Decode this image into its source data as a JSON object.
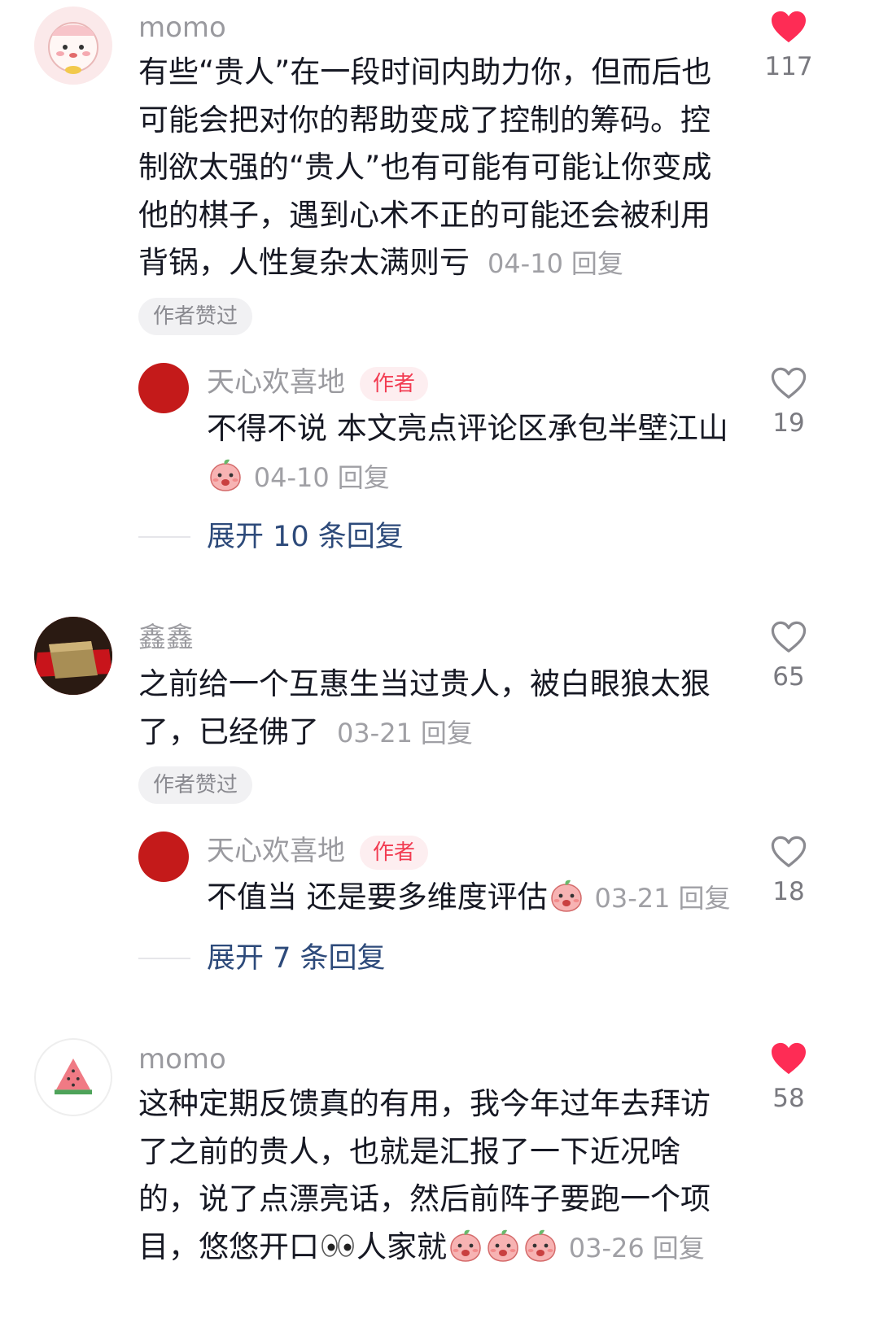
{
  "comments": [
    {
      "username": "momo",
      "text": "有些“贵人”在一段时间内助力你，但而后也可能会把对你的帮助变成了控制的筹码。控制欲太强的“贵人”也有可能有可能让你变成他的棋子，遇到心术不正的可能还会被利用背锅，人性复杂太满则亏",
      "date": "04-10",
      "reply_label": "回复",
      "chip": "作者赞过",
      "likes": "117",
      "liked": true,
      "replies": {
        "username": "天心欢喜地",
        "author_tag": "作者",
        "text": "不得不说 本文亮点评论区承包半壁江山",
        "emoji": "peach-emoji",
        "date": "04-10",
        "reply_label": "回复",
        "likes": "19",
        "expand": "展开 10 条回复"
      }
    },
    {
      "username": "鑫鑫",
      "text": "之前给一个互惠生当过贵人，被白眼狼太狠了，已经佛了",
      "date": "03-21",
      "reply_label": "回复",
      "chip": "作者赞过",
      "likes": "65",
      "liked": false,
      "replies": {
        "username": "天心欢喜地",
        "author_tag": "作者",
        "text": "不值当 还是要多维度评估",
        "emoji": "peach-emoji",
        "date": "03-21",
        "reply_label": "回复",
        "likes": "18",
        "expand": "展开 7 条回复"
      }
    },
    {
      "username": "momo",
      "text_a": "这种定期反馈真的有用，我今年过年去拜访了之前的贵人，也就是汇报了一下近况啥的，说了点漂亮话，然后前阵子要跑一个项目，悠悠开口",
      "text_b": "人家就",
      "emojis": [
        "eyes-emoji",
        "peach-emoji",
        "peach-emoji",
        "peach-emoji"
      ],
      "date": "03-26",
      "reply_label": "回复",
      "likes": "58",
      "liked": true
    }
  ],
  "colors": {
    "like_active": "#fe2c55",
    "link": "#2d4a7a",
    "author_tag": "#f23c52"
  }
}
